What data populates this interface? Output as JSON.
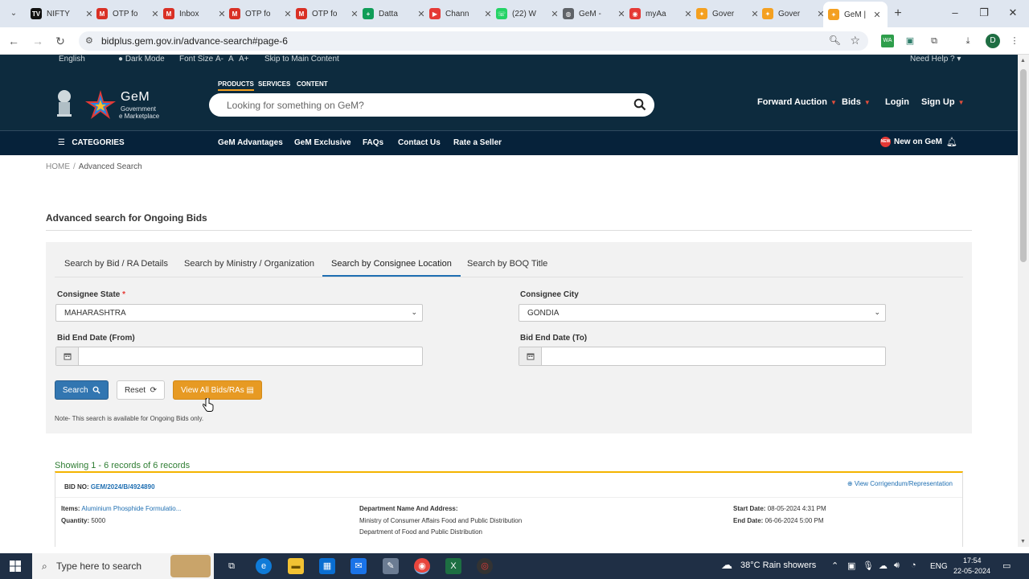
{
  "browser": {
    "tabs": [
      {
        "title": "NIFTY",
        "fav_color": "#111111",
        "fav_glyph": "TV"
      },
      {
        "title": "OTP fo",
        "fav_color": "#d93025",
        "fav_glyph": "M"
      },
      {
        "title": "Inbox",
        "fav_color": "#d93025",
        "fav_glyph": "M"
      },
      {
        "title": "OTP fo",
        "fav_color": "#d93025",
        "fav_glyph": "M"
      },
      {
        "title": "OTP fo",
        "fav_color": "#d93025",
        "fav_glyph": "M"
      },
      {
        "title": "Datta",
        "fav_color": "#0f9d58",
        "fav_glyph": "+"
      },
      {
        "title": "Chann",
        "fav_color": "#e53935",
        "fav_glyph": "▶"
      },
      {
        "title": "(22) W",
        "fav_color": "#25d366",
        "fav_glyph": "☏"
      },
      {
        "title": "GeM -",
        "fav_color": "#5f6368",
        "fav_glyph": "◍"
      },
      {
        "title": "myAa",
        "fav_color": "#e53935",
        "fav_glyph": "◉"
      },
      {
        "title": "Gover",
        "fav_color": "#f4a020",
        "fav_glyph": "✦"
      },
      {
        "title": "Gover",
        "fav_color": "#f4a020",
        "fav_glyph": "✦"
      },
      {
        "title": "GeM |",
        "fav_color": "#f4a020",
        "fav_glyph": "✦"
      }
    ],
    "url": "bidplus.gem.gov.in/advance-search#page-6",
    "profile_initial": "D",
    "ext_wa": "WA"
  },
  "header": {
    "top_links": [
      "English",
      "Dark Mode",
      "Font Size",
      "A-",
      "A",
      "A+",
      "Skip to Main Content"
    ],
    "need_help": "Need Help ?",
    "logo_title": "GeM",
    "logo_sub1": "Government",
    "logo_sub2": "e Marketplace",
    "product_tabs": [
      "PRODUCTS",
      "SERVICES",
      "CONTENT"
    ],
    "search_placeholder": "Looking for something on GeM?",
    "links": [
      "Forward Auction",
      "Bids",
      "Login",
      "Sign Up"
    ]
  },
  "nav": {
    "categories": "CATEGORIES",
    "items": [
      "GeM Advantages",
      "GeM Exclusive",
      "FAQs",
      "Contact Us",
      "Rate a Seller"
    ],
    "new_on_gem": "New on GeM",
    "new_badge": "NEW"
  },
  "breadcrumb": {
    "home": "HOME",
    "separator": "/",
    "current": "Advanced Search"
  },
  "page_title": "Advanced search for Ongoing Bids",
  "search_tabs": [
    "Search by Bid / RA Details",
    "Search by Ministry / Organization",
    "Search by Consignee Location",
    "Search by BOQ Title"
  ],
  "form": {
    "state_label": "Consignee State",
    "required_mark": "*",
    "state_value": "MAHARASHTRA",
    "city_label": "Consignee City",
    "city_value": "GONDIA",
    "from_label": "Bid End Date (From)",
    "to_label": "Bid End Date (To)",
    "from_value": "",
    "to_value": "",
    "search_btn": "Search",
    "reset_btn": "Reset",
    "view_all_btn": "View All Bids/RAs",
    "note": "Note- This search is available for Ongoing Bids only."
  },
  "results": {
    "showing": "Showing 1 - 6 records of 6 records",
    "bid_no_label": "BID NO:",
    "bid_no": "GEM/2024/B/4924890",
    "corrigendum": "View Corrigendum/Representation",
    "items_label": "Items:",
    "items_value": "Aluminium Phosphide Formulatio...",
    "qty_label": "Quantity:",
    "qty_value": "5000",
    "dept_label": "Department Name And Address:",
    "dept_line1": "Ministry of Consumer Affairs Food and Public Distribution",
    "dept_line2": "Department of Food and Public Distribution",
    "start_label": "Start Date:",
    "start_value": "08-05-2024 4:31 PM",
    "end_label": "End Date:",
    "end_value": "06-06-2024 5:00 PM"
  },
  "taskbar": {
    "search_text": "Type here to search",
    "weather": "38°C  Rain showers",
    "lang": "ENG",
    "time": "17:54",
    "date": "22-05-2024"
  },
  "colors": {
    "header_bg": "#0d2b3e",
    "nav_bg": "#06223a",
    "primary_btn": "#3276b1",
    "accent_btn": "#e79a23",
    "link": "#1f6fb2",
    "success": "#2e7d32"
  }
}
